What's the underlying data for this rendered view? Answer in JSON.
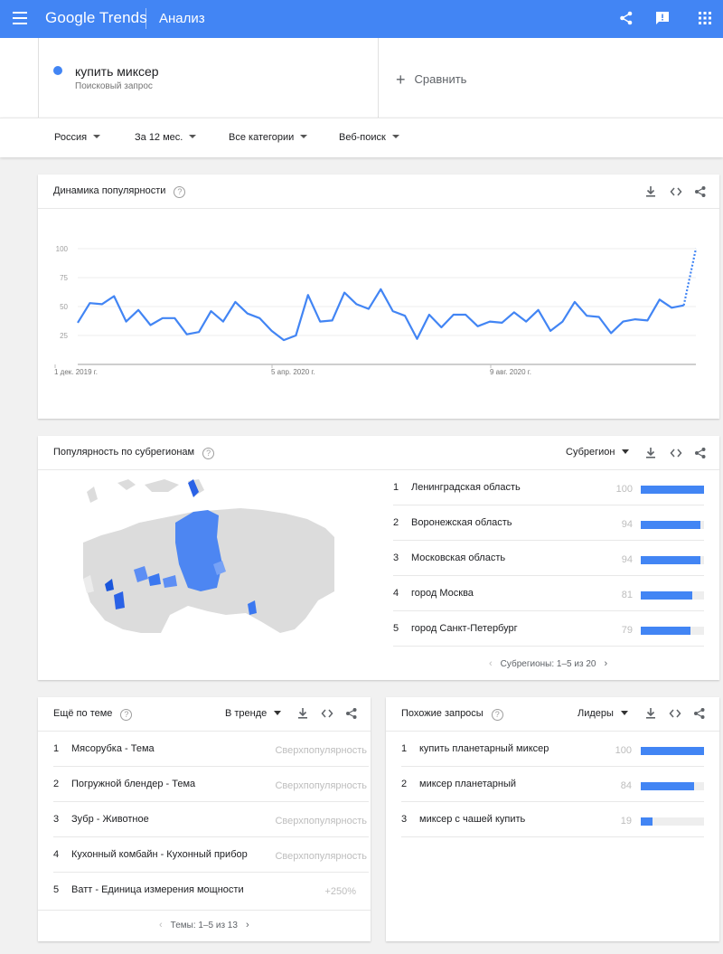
{
  "header": {
    "logo": "Google Trends",
    "section": "Анализ",
    "icons": [
      "menu-icon",
      "share-icon",
      "feedback-icon",
      "apps-icon"
    ]
  },
  "search": {
    "term": "купить миксер",
    "term_type": "Поисковый запрос",
    "term_color": "#4285f4",
    "compare_label": "Сравнить"
  },
  "filters": {
    "region": "Россия",
    "period": "За 12 мес.",
    "category": "Все категории",
    "search_type": "Веб-поиск"
  },
  "interest_over_time": {
    "title": "Динамика популярности",
    "chart_data": {
      "type": "line",
      "y_ticks": [
        "100",
        "75",
        "50",
        "25"
      ],
      "x_ticks": [
        "1 дек. 2019 г.",
        "5 апр. 2020 г.",
        "9 авг. 2020 г."
      ],
      "ylim": [
        0,
        100
      ],
      "series": [
        {
          "color": "#4285f4",
          "values": [
            36,
            53,
            52,
            59,
            37,
            47,
            34,
            40,
            40,
            26,
            28,
            46,
            37,
            54,
            44,
            40,
            29,
            21,
            25,
            60,
            37,
            38,
            62,
            52,
            48,
            65,
            46,
            42,
            22,
            43,
            32,
            43,
            43,
            33,
            37,
            36,
            45,
            37,
            47,
            29,
            37,
            54,
            42,
            41,
            27,
            37,
            39,
            38,
            56,
            49,
            51,
            100
          ],
          "partial_last": true
        }
      ]
    }
  },
  "subregions": {
    "title": "Популярность по субрегионам",
    "dropdown": "Субрегион",
    "items": [
      {
        "rank": "1",
        "name": "Ленинградская область",
        "value": "100",
        "pct": 100
      },
      {
        "rank": "2",
        "name": "Воронежская область",
        "value": "94",
        "pct": 94
      },
      {
        "rank": "3",
        "name": "Московская область",
        "value": "94",
        "pct": 94
      },
      {
        "rank": "4",
        "name": "город Москва",
        "value": "81",
        "pct": 81
      },
      {
        "rank": "5",
        "name": "город Санкт-Петербург",
        "value": "79",
        "pct": 79
      }
    ],
    "pager": "Субрегионы: 1–5 из 20"
  },
  "related_topics": {
    "title": "Ещё по теме",
    "dropdown": "В тренде",
    "items": [
      {
        "rank": "1",
        "name": "Мясорубка - Тема",
        "value": "Сверхпопулярность"
      },
      {
        "rank": "2",
        "name": "Погружной блендер - Тема",
        "value": "Сверхпопулярность"
      },
      {
        "rank": "3",
        "name": "Зубр - Животное",
        "value": "Сверхпопулярность"
      },
      {
        "rank": "4",
        "name": "Кухонный комбайн - Кухонный прибор",
        "value": "Сверхпопулярность"
      },
      {
        "rank": "5",
        "name": "Ватт - Единица измерения мощности",
        "value": "+250%"
      }
    ],
    "pager": "Темы: 1–5 из 13"
  },
  "related_queries": {
    "title": "Похожие запросы",
    "dropdown": "Лидеры",
    "items": [
      {
        "rank": "1",
        "name": "купить планетарный миксер",
        "value": "100",
        "pct": 100
      },
      {
        "rank": "2",
        "name": "миксер планетарный",
        "value": "84",
        "pct": 84
      },
      {
        "rank": "3",
        "name": "миксер с чашей купить",
        "value": "19",
        "pct": 19
      }
    ]
  }
}
